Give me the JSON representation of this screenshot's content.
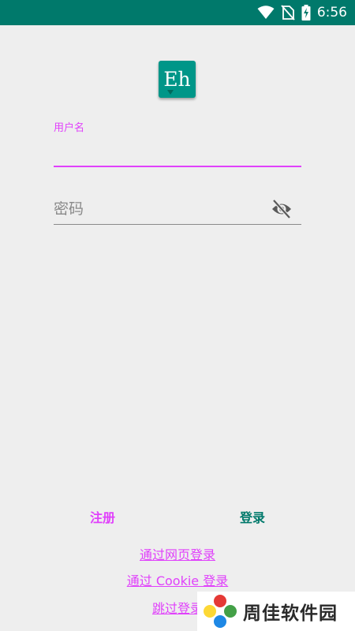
{
  "status_bar": {
    "time": "6:56",
    "icons": [
      "wifi-icon",
      "no-sim-icon",
      "battery-charging-icon"
    ],
    "color": "#00796b"
  },
  "app": {
    "logo_text": "Eh",
    "accent": "#e040fb",
    "primary": "#009688"
  },
  "form": {
    "username_label": "用户名",
    "username_value": "",
    "password_placeholder": "密码"
  },
  "buttons": {
    "register": "注册",
    "login": "登录"
  },
  "links": {
    "web_login": "通过网页登录",
    "cookie_login": "通过 Cookie 登录",
    "skip_login": "跳过登录"
  },
  "watermark": {
    "text": "周佳软件园"
  }
}
